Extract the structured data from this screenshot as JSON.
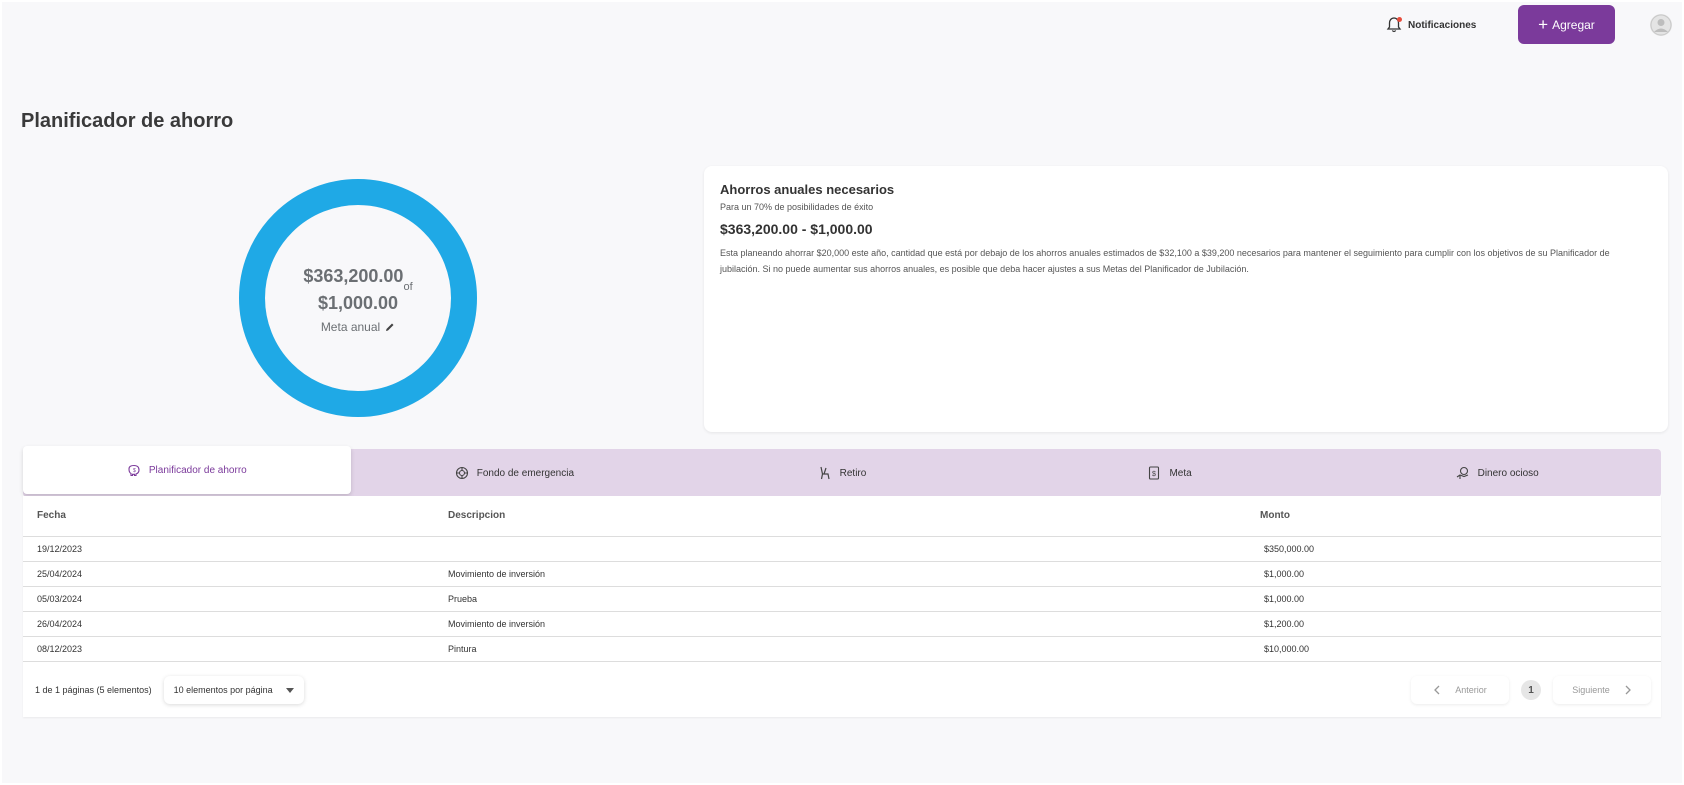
{
  "header": {
    "notifications_label": "Notificaciones",
    "add_label": "Agregar"
  },
  "page": {
    "title": "Planificador de ahorro"
  },
  "donut": {
    "current": "$363,200.00",
    "of": "of",
    "goal": "$1,000.00",
    "label": "Meta anual",
    "progress": 1.0,
    "color": "#1fa9e6"
  },
  "summary": {
    "title": "Ahorros anuales necesarios",
    "subtitle": "Para un 70% de posibilidades de éxito",
    "range": "$363,200.00 - $1,000.00",
    "description": "Esta planeando ahorrar $20,000 este año, cantidad que está por debajo de los ahorros anuales estimados de $32,100 a $39,200 necesarios para mantener el seguimiento para cumplir con los objetivos de su Planificador de jubilación. Si no puede aumentar sus ahorros anuales, es posible que deba hacer ajustes a sus Metas del Planificador de Jubilación."
  },
  "tabs": [
    {
      "label": "Planificador de ahorro",
      "icon": "piggy-bank-icon",
      "active": true
    },
    {
      "label": "Fondo de emergencia",
      "icon": "lifebuoy-icon",
      "active": false
    },
    {
      "label": "Retiro",
      "icon": "chair-icon",
      "active": false
    },
    {
      "label": "Meta",
      "icon": "dollar-document-icon",
      "active": false
    },
    {
      "label": "Dinero ocioso",
      "icon": "money-hand-icon",
      "active": false
    }
  ],
  "table": {
    "headers": [
      "Fecha",
      "Descripcion",
      "Monto"
    ],
    "rows": [
      [
        "19/12/2023",
        "",
        "$350,000.00"
      ],
      [
        "25/04/2024",
        "Movimiento de inversión",
        "$1,000.00"
      ],
      [
        "05/03/2024",
        "Prueba",
        "$1,000.00"
      ],
      [
        "26/04/2024",
        "Movimiento de inversión",
        "$1,200.00"
      ],
      [
        "08/12/2023",
        "Pintura",
        "$10,000.00"
      ]
    ]
  },
  "pagination": {
    "info": "1 de 1 páginas (5 elementos)",
    "per_page": "10 elementos por página",
    "prev": "Anterior",
    "page": "1",
    "next": "Siguiente"
  },
  "colors": {
    "brand": "#7b3a9b",
    "tab_bg": "#e2d4e8",
    "donut": "#1fa9e6"
  }
}
